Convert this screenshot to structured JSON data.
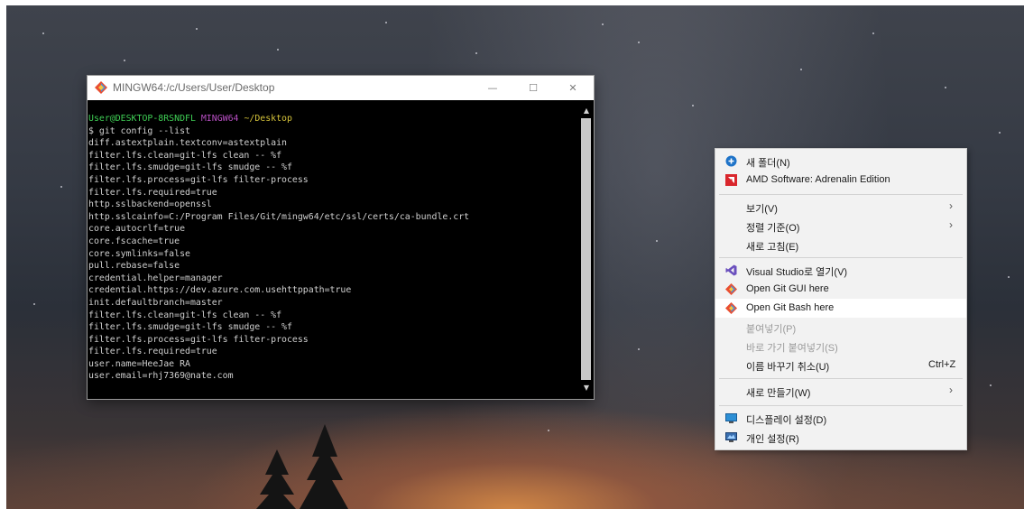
{
  "terminal": {
    "title": "MINGW64:/c/Users/User/Desktop",
    "prompt": {
      "user_host": "User@DESKTOP-8RSNDFL",
      "system": "MINGW64",
      "path": "~/Desktop"
    },
    "command": "$ git config --list",
    "output": [
      "diff.astextplain.textconv=astextplain",
      "filter.lfs.clean=git-lfs clean -- %f",
      "filter.lfs.smudge=git-lfs smudge -- %f",
      "filter.lfs.process=git-lfs filter-process",
      "filter.lfs.required=true",
      "http.sslbackend=openssl",
      "http.sslcainfo=C:/Program Files/Git/mingw64/etc/ssl/certs/ca-bundle.crt",
      "core.autocrlf=true",
      "core.fscache=true",
      "core.symlinks=false",
      "pull.rebase=false",
      "credential.helper=manager",
      "credential.https://dev.azure.com.usehttppath=true",
      "init.defaultbranch=master",
      "filter.lfs.clean=git-lfs clean -- %f",
      "filter.lfs.smudge=git-lfs smudge -- %f",
      "filter.lfs.process=git-lfs filter-process",
      "filter.lfs.required=true",
      "user.name=HeeJae RA",
      "user.email=rhj7369@nate.com"
    ],
    "buttons": {
      "minimize": "—",
      "maximize": "☐",
      "close": "✕"
    },
    "scroll": {
      "up": "▲",
      "down": "▼"
    }
  },
  "context_menu": {
    "items": [
      {
        "label": "새 폴더(N)",
        "icon": "new-folder-icon"
      },
      {
        "label": "AMD Software: Adrenalin Edition",
        "icon": "amd-icon"
      },
      {
        "label": "보기(V)",
        "arrow": "›"
      },
      {
        "label": "정렬 기준(O)",
        "arrow": "›"
      },
      {
        "label": "새로 고침(E)"
      },
      {
        "label": "Visual Studio로 열기(V)",
        "icon": "visual-studio-icon"
      },
      {
        "label": "Open Git GUI here",
        "icon": "git-icon"
      },
      {
        "label": "Open Git Bash here",
        "icon": "git-icon"
      },
      {
        "label": "붙여넣기(P)",
        "disabled": true
      },
      {
        "label": "바로 가기 붙여넣기(S)",
        "disabled": true
      },
      {
        "label": "이름 바꾸기 취소(U)",
        "shortcut": "Ctrl+Z"
      },
      {
        "label": "새로 만들기(W)",
        "arrow": "›"
      },
      {
        "label": "디스플레이 설정(D)",
        "icon": "display-icon"
      },
      {
        "label": "개인 설정(R)",
        "icon": "personalize-icon"
      }
    ],
    "colors": {
      "git": "#e94e31",
      "amd": "#d9262c",
      "visual_studio": "#6a4fbd",
      "folder": "#1e73c8"
    }
  }
}
